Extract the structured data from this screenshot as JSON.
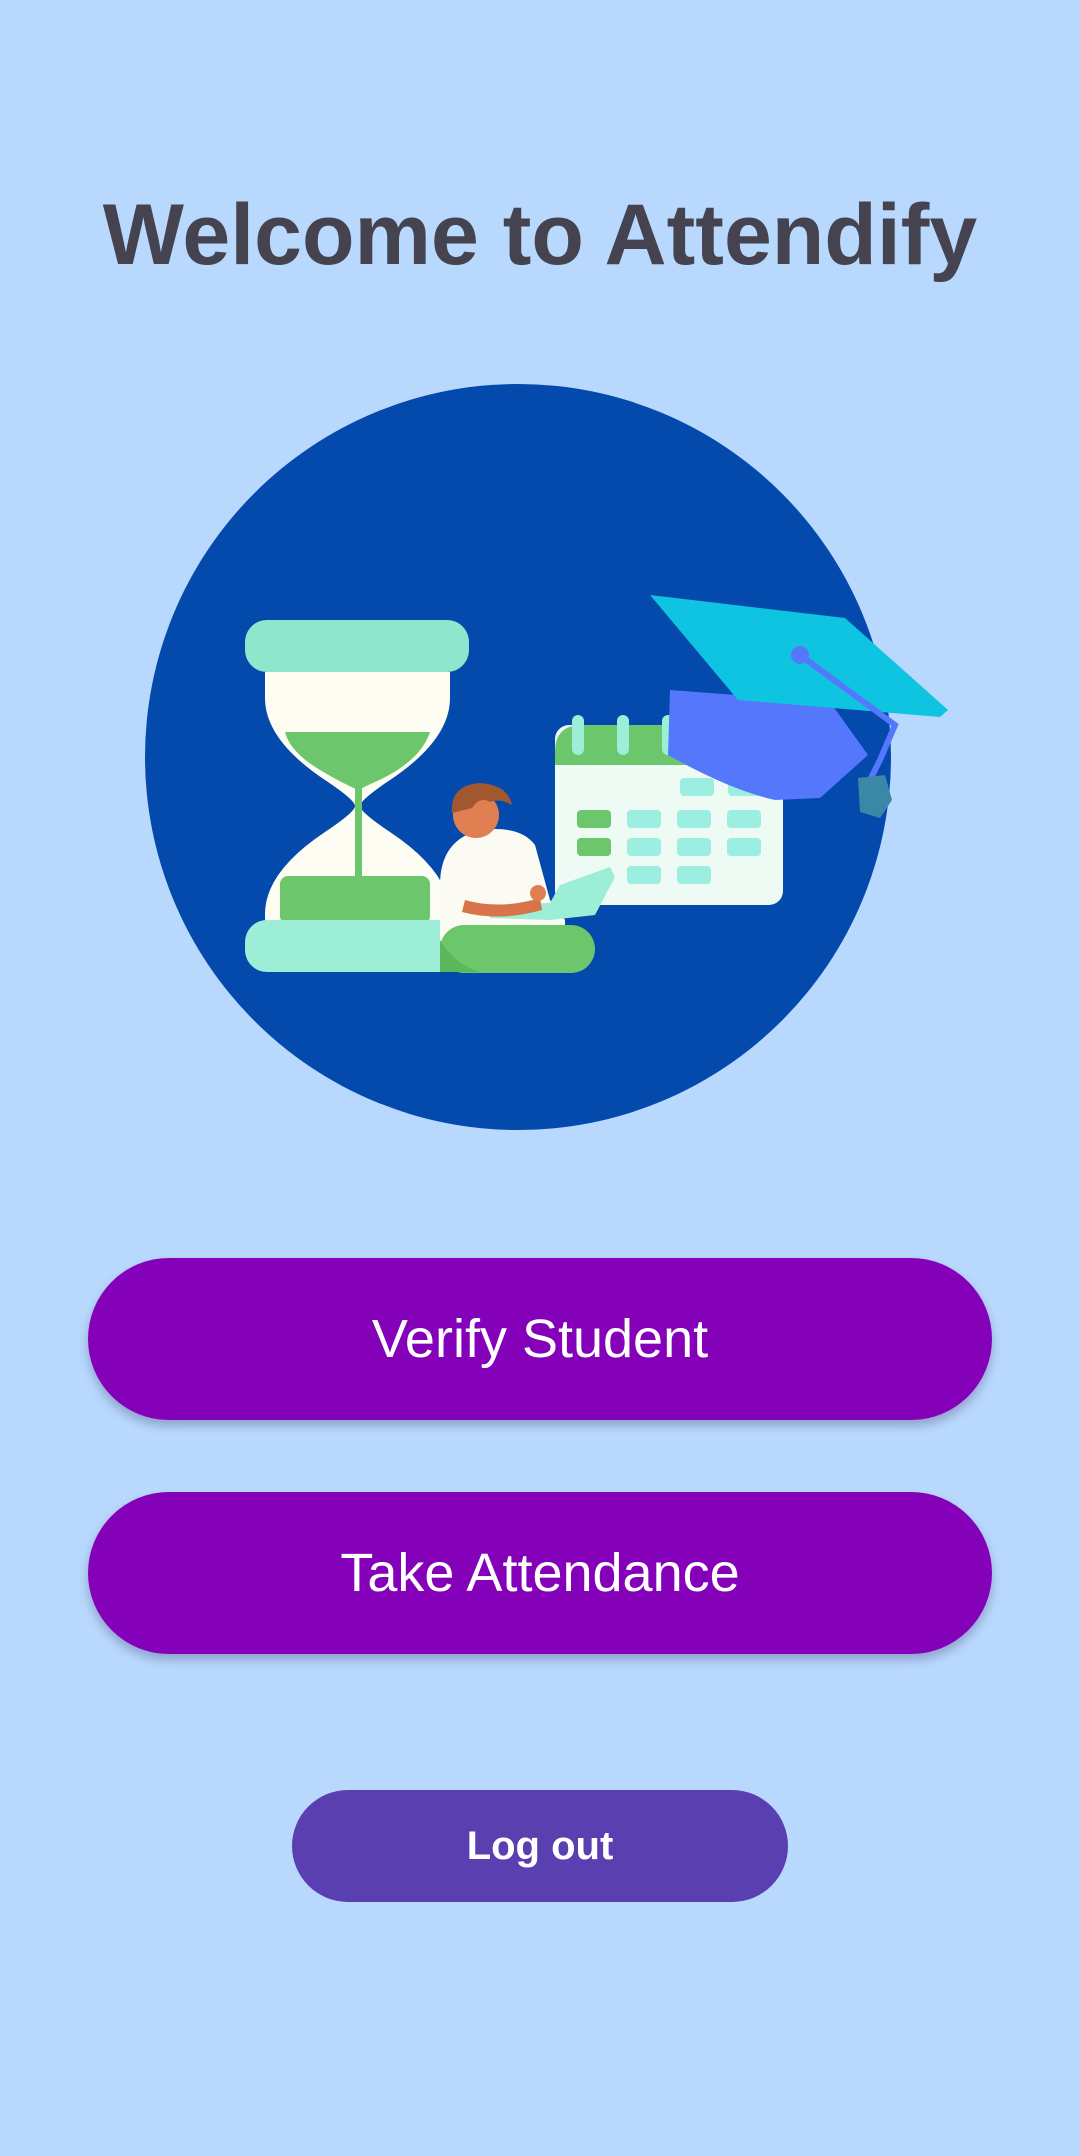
{
  "app": {
    "title": "Welcome to Attendify"
  },
  "hero": {
    "illustration": "attendance-illustration",
    "icons": [
      "hourglass-icon",
      "calendar-icon",
      "graduation-cap-icon",
      "person-with-laptop-icon"
    ]
  },
  "actions": {
    "verify_student_label": "Verify Student",
    "take_attendance_label": "Take Attendance",
    "logout_label": "Log out"
  },
  "colors": {
    "background": "#b8d9fd",
    "title_text": "#45434f",
    "primary_button": "#8501b9",
    "logout_button": "#5a3fb0",
    "hero_circle": "#034aac"
  }
}
